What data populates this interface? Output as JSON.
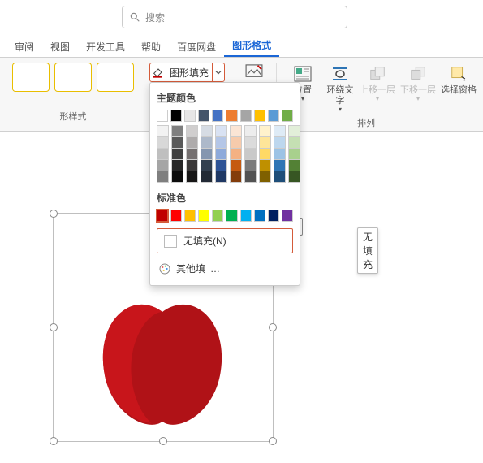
{
  "search": {
    "placeholder": "搜索"
  },
  "tabs": {
    "review": "审阅",
    "view": "视图",
    "dev": "开发工具",
    "help": "帮助",
    "baidu": "百度网盘",
    "shapefmt": "图形格式"
  },
  "ribbon": {
    "styles_label": "形样式",
    "fill_label": "图形填充",
    "position": "位置",
    "wrap": "环绕文\n字",
    "bring_fwd": "上移一层",
    "send_back": "下移一层",
    "sel_pane": "选择窗格",
    "arrange_label": "排列"
  },
  "dropdown": {
    "theme_hdr": "主题颜色",
    "theme_colors": [
      "#ffffff",
      "#000000",
      "#e7e6e6",
      "#44546a",
      "#4472c4",
      "#ed7d31",
      "#a5a5a5",
      "#ffc000",
      "#5b9bd5",
      "#70ad47"
    ],
    "shades": [
      [
        "#f2f2f2",
        "#7f7f7f",
        "#d0cece",
        "#d6dce4",
        "#d9e2f3",
        "#fbe5d5",
        "#ededed",
        "#fff2cc",
        "#deebf6",
        "#e2efd9"
      ],
      [
        "#d8d8d8",
        "#595959",
        "#aeabab",
        "#adb9ca",
        "#b4c6e7",
        "#f7cbac",
        "#dbdbdb",
        "#fee599",
        "#bdd7ee",
        "#c5e0b3"
      ],
      [
        "#bfbfbf",
        "#3f3f3f",
        "#757070",
        "#8496b0",
        "#8eaadb",
        "#f4b183",
        "#c9c9c9",
        "#ffd965",
        "#9cc3e5",
        "#a8d08d"
      ],
      [
        "#a5a5a5",
        "#262626",
        "#3a3838",
        "#323f4f",
        "#2f5496",
        "#c55a11",
        "#7b7b7b",
        "#bf9000",
        "#2e75b5",
        "#538135"
      ],
      [
        "#7f7f7f",
        "#0c0c0c",
        "#171616",
        "#222a35",
        "#1f3864",
        "#833c0b",
        "#525252",
        "#7f6000",
        "#1e4e79",
        "#375623"
      ]
    ],
    "std_hdr": "标准色",
    "std_colors": [
      "#c00000",
      "#ff0000",
      "#ffc000",
      "#ffff00",
      "#92d050",
      "#00b050",
      "#00b0f0",
      "#0070c0",
      "#002060",
      "#7030a0"
    ],
    "nofill": "无填充(N)",
    "morefill": "其他填",
    "tooltip": "无填充"
  }
}
